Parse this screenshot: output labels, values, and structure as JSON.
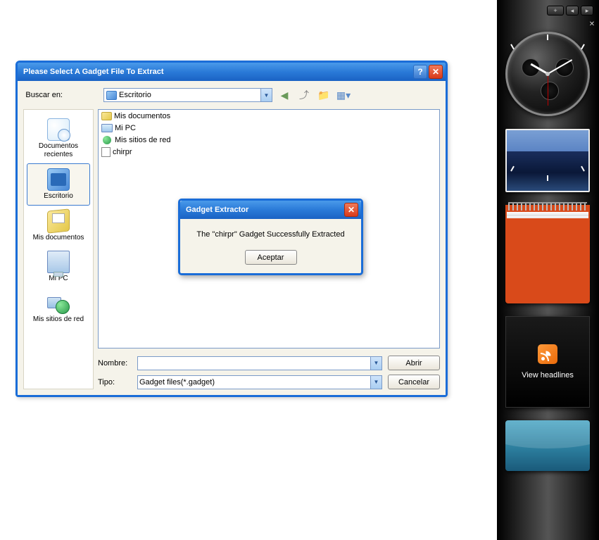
{
  "dialog": {
    "title": "Please Select A Gadget File To Extract",
    "search_label": "Buscar en:",
    "search_value": "Escritorio",
    "name_label": "Nombre:",
    "name_value": "",
    "type_label": "Tipo:",
    "type_value": "Gadget files(*.gadget)",
    "open_btn": "Abrir",
    "cancel_btn": "Cancelar"
  },
  "places": [
    {
      "label": "Documentos recientes"
    },
    {
      "label": "Escritorio"
    },
    {
      "label": "Mis documentos"
    },
    {
      "label": "Mi PC"
    },
    {
      "label": "Mis sitios de red"
    }
  ],
  "files": [
    {
      "label": "Mis documentos"
    },
    {
      "label": "Mi PC"
    },
    {
      "label": "Mis sitios de red"
    },
    {
      "label": "chirpr"
    }
  ],
  "alert": {
    "title": "Gadget Extractor",
    "message": "The \"chirpr\" Gadget Successfully Extracted",
    "ok_btn": "Aceptar"
  },
  "sidebar": {
    "feed_label": "View headlines"
  }
}
